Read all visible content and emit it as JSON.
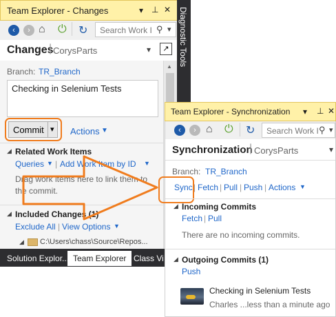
{
  "panel_changes": {
    "title": "Team Explorer - Changes",
    "heading": "Changes",
    "project": "CorysParts",
    "search_placeholder": "Search Work I",
    "branch_label": "Branch:",
    "branch_name": "TR_Branch",
    "comment_text": "Checking in Selenium Tests",
    "commit_button": "Commit",
    "actions_label": "Actions",
    "related_work_items_title": "Related Work Items",
    "queries_label": "Queries",
    "add_work_item_label": "Add Work Item by ID",
    "drag_hint": "Drag work items here to link them to the commit.",
    "included_changes_title": "Included Changes (1)",
    "exclude_all_label": "Exclude All",
    "view_options_label": "View Options",
    "path_text": "C:\\Users\\chass\\Source\\Repos..."
  },
  "sidebar": {
    "label": "Diagnostic Tools"
  },
  "bottom_tabs": [
    "Solution Explor...",
    "Team Explorer",
    "Class Vi"
  ],
  "panel_sync": {
    "title": "Team Explorer - Synchronization",
    "heading": "Synchronization",
    "project": "CorysParts",
    "search_placeholder": "Search Work I",
    "branch_label": "Branch:",
    "branch_name": "TR_Branch",
    "actions": [
      "Sync",
      "Fetch",
      "Pull",
      "Push",
      "Actions"
    ],
    "incoming_title": "Incoming Commits",
    "incoming_links": [
      "Fetch",
      "Pull"
    ],
    "incoming_empty": "There are no incoming commits.",
    "outgoing_title": "Outgoing Commits (1)",
    "outgoing_link": "Push",
    "commit_message": "Checking in Selenium Tests",
    "commit_meta": "Charles ...less than a minute ago"
  },
  "colors": {
    "titlebar": "#fff1a8",
    "accent_orange": "#f07c1d",
    "link_blue": "#1e66c9"
  }
}
